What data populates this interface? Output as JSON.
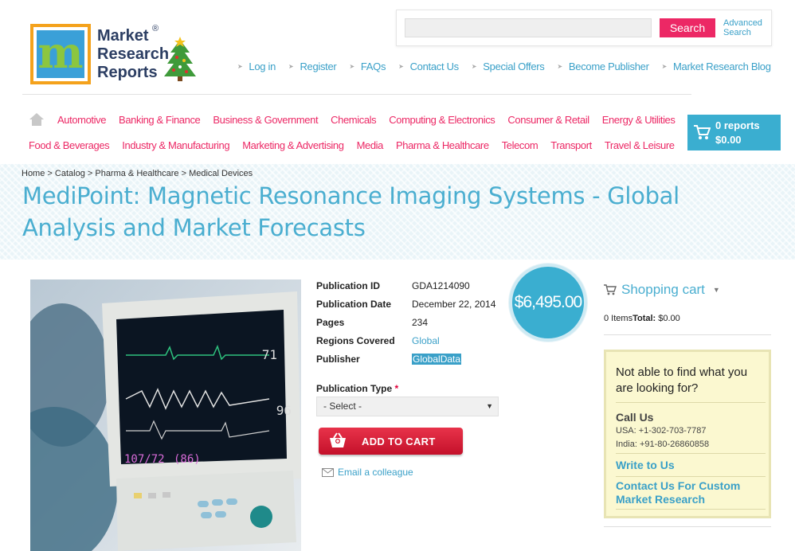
{
  "logo": {
    "line1": "Market",
    "line2": "Research",
    "line3": "Reports",
    "reg": "®"
  },
  "search": {
    "placeholder": "",
    "button": "Search",
    "advanced_line1": "Advanced",
    "advanced_line2": "Search"
  },
  "topnav": [
    "Log in",
    "Register",
    "FAQs",
    "Contact Us",
    "Special Offers",
    "Become Publisher",
    "Market Research Blog"
  ],
  "categories_row1": [
    "Automotive",
    "Banking & Finance",
    "Business & Government",
    "Chemicals",
    "Computing & Electronics",
    "Consumer & Retail",
    "Energy & Utilities"
  ],
  "categories_row2": [
    "Food & Beverages",
    "Industry & Manufacturing",
    "Marketing & Advertising",
    "Media",
    "Pharma & Healthcare",
    "Telecom",
    "Transport",
    "Travel & Leisure"
  ],
  "cart": {
    "reports": "0 reports",
    "total": "$0.00"
  },
  "breadcrumb": {
    "home": "Home",
    "sep": " > ",
    "catalog": "Catalog",
    "category": "Pharma & Healthcare",
    "sub": "Medical Devices"
  },
  "title": "MediPoint: Magnetic Resonance Imaging Systems - Global Analysis and Market Forecasts",
  "details": {
    "pub_id_label": "Publication ID",
    "pub_id": "GDA1214090",
    "pub_date_label": "Publication Date",
    "pub_date": "December 22, 2014",
    "pages_label": "Pages",
    "pages": "234",
    "regions_label": "Regions Covered",
    "regions": "Global",
    "publisher_label": "Publisher",
    "publisher": "GlobalData"
  },
  "price": "$6,495.00",
  "pubtype": {
    "label": "Publication Type",
    "required": "*",
    "selected": "- Select -"
  },
  "add_to_cart": "ADD TO CART",
  "email_colleague": "Email a colleague",
  "shopping_cart": {
    "title": "Shopping cart",
    "items": "0 Items",
    "total_label": "Total:",
    "total": "$0.00"
  },
  "help": {
    "question": "Not able to find what you are looking for?",
    "call_us": "Call Us",
    "usa": "USA: +1-302-703-7787",
    "india": "India: +91-80-26860858",
    "write": "Write to Us",
    "custom": "Contact Us For Custom Market Research"
  },
  "colors": {
    "accent_blue": "#3aaed0",
    "pink": "#ec2865",
    "red_button": "#d41f35"
  }
}
